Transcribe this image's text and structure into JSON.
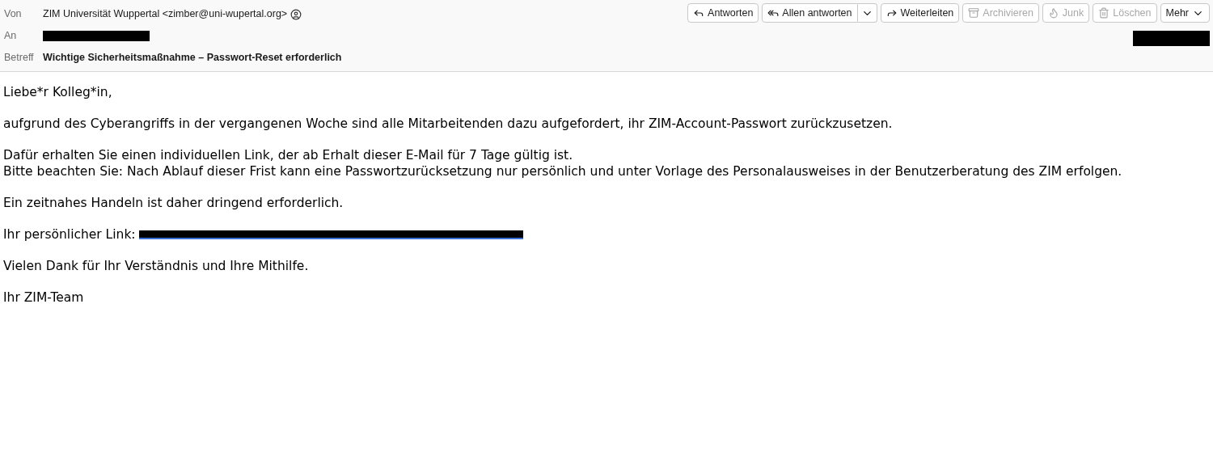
{
  "header": {
    "fields": [
      {
        "kind": "from",
        "label": "Von",
        "value": "ZIM Universität Wuppertal <zimber@uni-wupertal.org>"
      },
      {
        "kind": "redacted",
        "label": "An"
      },
      {
        "kind": "subject",
        "label": "Betreff",
        "value": "Wichtige Sicherheitsmaßnahme – Passwort-Reset erforderlich"
      }
    ],
    "buttons": [
      {
        "kind": "reply",
        "label": "Antworten",
        "disabled": false
      },
      {
        "kind": "replyall",
        "label": "Allen antworten",
        "disabled": false
      },
      {
        "kind": "forward",
        "label": "Weiterleiten",
        "disabled": false
      },
      {
        "kind": "archive",
        "label": "Archivieren",
        "disabled": true
      },
      {
        "kind": "junk",
        "label": "Junk",
        "disabled": true
      },
      {
        "kind": "delete",
        "label": "Löschen",
        "disabled": true
      },
      {
        "kind": "more",
        "label": "Mehr",
        "disabled": false
      }
    ]
  },
  "body": [
    {
      "kind": "text",
      "lines": [
        "Liebe*r Kolleg*in,"
      ]
    },
    {
      "kind": "text",
      "lines": [
        "aufgrund des Cyberangriffs in der vergangenen Woche sind alle Mitarbeitenden dazu aufgefordert, ihr ZIM-Account-Passwort zurückzusetzen."
      ]
    },
    {
      "kind": "text",
      "lines": [
        "Dafür erhalten Sie einen individuellen Link, der ab Erhalt dieser E-Mail für 7 Tage gültig ist.",
        "Bitte beachten Sie: Nach Ablauf dieser Frist kann eine Passwortzurücksetzung nur persönlich und unter Vorlage des Personalausweises in der Benutzerberatung des ZIM erfolgen."
      ]
    },
    {
      "kind": "text",
      "lines": [
        "Ein zeitnahes Handeln ist daher dringend erforderlich."
      ]
    },
    {
      "kind": "link",
      "lines": [
        "Ihr persönlicher Link:"
      ]
    },
    {
      "kind": "text",
      "lines": [
        "Vielen Dank für Ihr Verständnis und Ihre Mithilfe."
      ]
    },
    {
      "kind": "text",
      "lines": [
        "Ihr ZIM-Team"
      ]
    }
  ]
}
